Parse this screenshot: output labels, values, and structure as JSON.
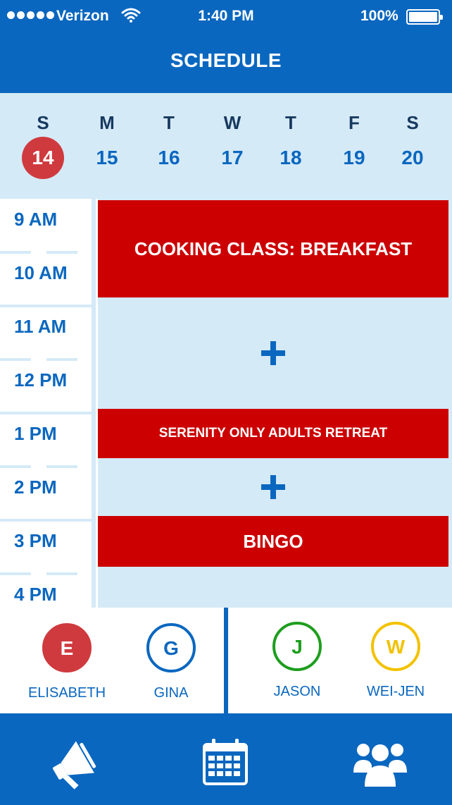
{
  "status": {
    "carrier": "Verizon",
    "time": "1:40 PM",
    "battery": "100%"
  },
  "header": {
    "title": "SCHEDULE"
  },
  "week": {
    "days": [
      {
        "dow": "S",
        "num": "14",
        "selected": true
      },
      {
        "dow": "M",
        "num": "15"
      },
      {
        "dow": "T",
        "num": "16"
      },
      {
        "dow": "W",
        "num": "17"
      },
      {
        "dow": "T",
        "num": "18"
      },
      {
        "dow": "F",
        "num": "19"
      },
      {
        "dow": "S",
        "num": "20"
      }
    ]
  },
  "times": [
    "9 AM",
    "10 AM",
    "11 AM",
    "12 PM",
    "1 PM",
    "2 PM",
    "3 PM",
    "4 PM"
  ],
  "events": {
    "cooking": "COOKING CLASS: BREAKFAST",
    "serenity": "SERENITY ONLY ADULTS RETREAT",
    "bingo": "BINGO"
  },
  "people": [
    {
      "initial": "E",
      "name": "ELISABETH",
      "color": "#cf3a3e",
      "filled": true
    },
    {
      "initial": "G",
      "name": "GINA",
      "color": "#0a67bf"
    },
    {
      "initial": "J",
      "name": "JASON",
      "color": "#1e9e1e"
    },
    {
      "initial": "W",
      "name": "WEI-JEN",
      "color": "#f2c200"
    }
  ],
  "colors": {
    "brand": "#0a67bf",
    "light": "#d5eaf7",
    "event": "#cc0000",
    "today": "#cf3a3e"
  },
  "tabs": [
    "megaphone-icon",
    "calendar-icon",
    "group-icon"
  ]
}
